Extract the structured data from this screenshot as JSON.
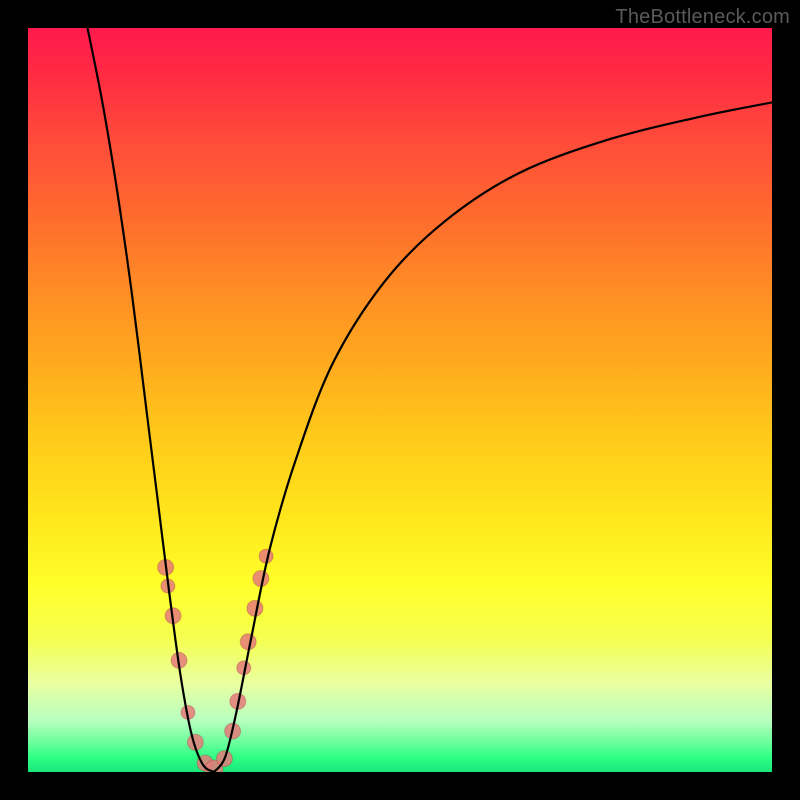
{
  "watermark": "TheBottleneck.com",
  "colors": {
    "frame": "#000000",
    "curve_stroke": "#000000",
    "point_fill": "#e57a7a",
    "gradient_top": "#ff1a4d",
    "gradient_bottom": "#18e87a"
  },
  "chart_data": {
    "type": "line",
    "title": "",
    "xlabel": "",
    "ylabel": "",
    "xlim": [
      0,
      100
    ],
    "ylim": [
      0,
      100
    ],
    "curve": {
      "left_branch": [
        {
          "x": 8.0,
          "y": 100.0
        },
        {
          "x": 10.0,
          "y": 90.0
        },
        {
          "x": 12.0,
          "y": 78.0
        },
        {
          "x": 14.0,
          "y": 64.0
        },
        {
          "x": 16.0,
          "y": 48.0
        },
        {
          "x": 17.5,
          "y": 36.0
        },
        {
          "x": 19.0,
          "y": 24.0
        },
        {
          "x": 20.5,
          "y": 13.0
        },
        {
          "x": 22.0,
          "y": 5.0
        },
        {
          "x": 23.5,
          "y": 1.0
        },
        {
          "x": 25.0,
          "y": 0.0
        }
      ],
      "right_branch": [
        {
          "x": 25.0,
          "y": 0.0
        },
        {
          "x": 26.5,
          "y": 2.0
        },
        {
          "x": 28.0,
          "y": 8.0
        },
        {
          "x": 30.0,
          "y": 18.0
        },
        {
          "x": 32.5,
          "y": 30.0
        },
        {
          "x": 36.0,
          "y": 42.0
        },
        {
          "x": 41.0,
          "y": 55.0
        },
        {
          "x": 48.0,
          "y": 66.0
        },
        {
          "x": 56.0,
          "y": 74.0
        },
        {
          "x": 66.0,
          "y": 80.5
        },
        {
          "x": 78.0,
          "y": 85.0
        },
        {
          "x": 90.0,
          "y": 88.0
        },
        {
          "x": 100.0,
          "y": 90.0
        }
      ]
    },
    "points": [
      {
        "x": 18.5,
        "y": 27.5,
        "r": 8
      },
      {
        "x": 18.8,
        "y": 25.0,
        "r": 7
      },
      {
        "x": 19.5,
        "y": 21.0,
        "r": 8
      },
      {
        "x": 20.3,
        "y": 15.0,
        "r": 8
      },
      {
        "x": 21.5,
        "y": 8.0,
        "r": 7
      },
      {
        "x": 22.5,
        "y": 4.0,
        "r": 8
      },
      {
        "x": 23.8,
        "y": 1.2,
        "r": 8
      },
      {
        "x": 25.0,
        "y": 0.4,
        "r": 9
      },
      {
        "x": 26.4,
        "y": 1.8,
        "r": 8
      },
      {
        "x": 27.5,
        "y": 5.5,
        "r": 8
      },
      {
        "x": 28.2,
        "y": 9.5,
        "r": 8
      },
      {
        "x": 29.0,
        "y": 14.0,
        "r": 7
      },
      {
        "x": 29.6,
        "y": 17.5,
        "r": 8
      },
      {
        "x": 30.5,
        "y": 22.0,
        "r": 8
      },
      {
        "x": 31.3,
        "y": 26.0,
        "r": 8
      },
      {
        "x": 32.0,
        "y": 29.0,
        "r": 7
      }
    ]
  }
}
